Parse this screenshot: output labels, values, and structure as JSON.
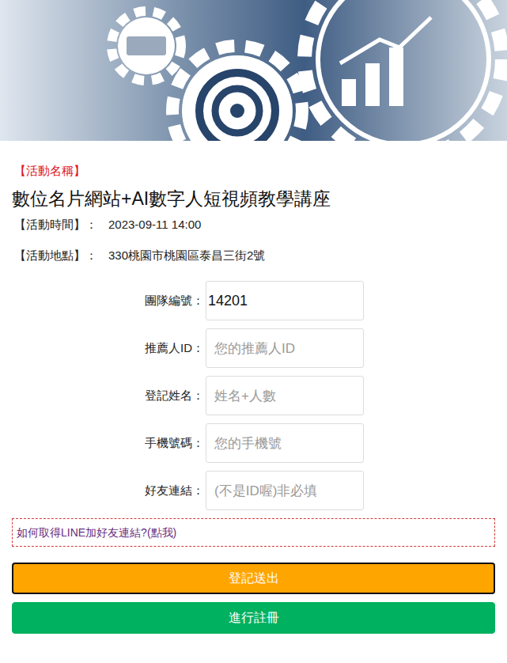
{
  "event": {
    "name_label": "【活動名稱】",
    "name": "數位名片網站+AI數字人短視頻教學講座",
    "time_label": "【活動時間】：",
    "time": "2023-09-11 14:00",
    "place_label": "【活動地點】：",
    "place": "330桃園市桃園區泰昌三街2號"
  },
  "form": {
    "fields": [
      {
        "label": "團隊編號：",
        "value": "14201",
        "placeholder": ""
      },
      {
        "label": "推薦人ID：",
        "value": "",
        "placeholder": "您的推薦人ID"
      },
      {
        "label": "登記姓名：",
        "value": "",
        "placeholder": "姓名+人數"
      },
      {
        "label": "手機號碼：",
        "value": "",
        "placeholder": "您的手機號"
      },
      {
        "label": "好友連結：",
        "value": "",
        "placeholder": "(不是ID喔)非必填"
      }
    ]
  },
  "help_link": "如何取得LINE加好友連結?(點我)",
  "buttons": [
    {
      "label": "登記送出",
      "kind": "submit"
    },
    {
      "label": "進行註冊",
      "kind": "register"
    }
  ]
}
